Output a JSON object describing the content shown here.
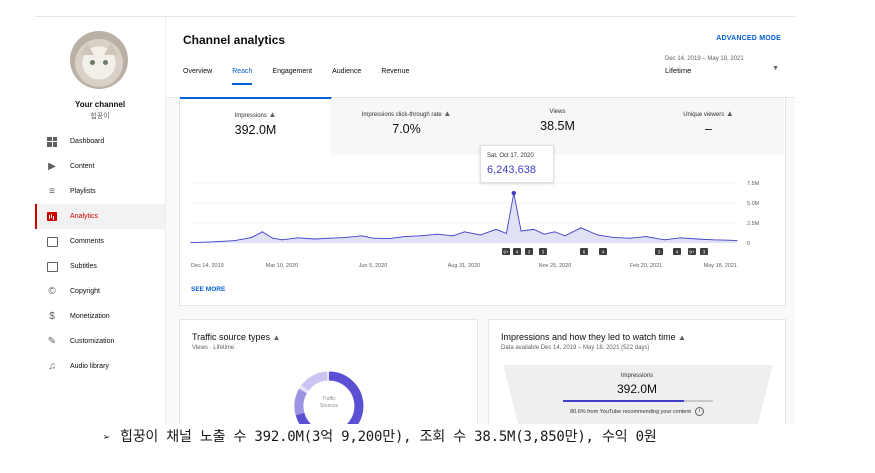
{
  "sidebar": {
    "channel_title": "Your channel",
    "channel_name": "힙꿍이",
    "items": [
      {
        "label": "Dashboard",
        "icon": "dashboard-icon",
        "active": false
      },
      {
        "label": "Content",
        "icon": "content-icon",
        "active": false
      },
      {
        "label": "Playlists",
        "icon": "playlists-icon",
        "active": false
      },
      {
        "label": "Analytics",
        "icon": "analytics-icon",
        "active": true
      },
      {
        "label": "Comments",
        "icon": "comments-icon",
        "active": false
      },
      {
        "label": "Subtitles",
        "icon": "subtitles-icon",
        "active": false
      },
      {
        "label": "Copyright",
        "icon": "copyright-icon",
        "active": false
      },
      {
        "label": "Monetization",
        "icon": "monetization-icon",
        "active": false
      },
      {
        "label": "Customization",
        "icon": "customization-icon",
        "active": false
      },
      {
        "label": "Audio library",
        "icon": "audio-library-icon",
        "active": false
      }
    ]
  },
  "header": {
    "title": "Channel analytics",
    "advanced_mode": "ADVANCED MODE",
    "tabs": [
      "Overview",
      "Reach",
      "Engagement",
      "Audience",
      "Revenue"
    ],
    "active_tab": "Reach",
    "date_range": "Dec 14, 2019 – May 18, 2021",
    "period": "Lifetime"
  },
  "metrics": [
    {
      "label": "Impressions",
      "value": "392.0M",
      "warning": true
    },
    {
      "label": "Impressions click-through rate",
      "value": "7.0%",
      "warning": true
    },
    {
      "label": "Views",
      "value": "38.5M",
      "warning": false
    },
    {
      "label": "Unique viewers",
      "value": "–",
      "warning": true
    }
  ],
  "tooltip": {
    "date": "Sat, Oct 17, 2020",
    "value": "6,243,638"
  },
  "chart_data": {
    "type": "area",
    "metric": "Impressions",
    "x_ticks": [
      "Dec 14, 2019",
      "Mar 10, 2020",
      "Jun 5, 2020",
      "Aug 31, 2020",
      "Nov 25, 2020",
      "Feb 20, 2021",
      "May 18, 2021"
    ],
    "y_ticks": [
      "7.5M",
      "5.0M",
      "2.5M",
      "0"
    ],
    "ylim": [
      0,
      7500000
    ],
    "x": [
      "2019-12-14",
      "2020-01-05",
      "2020-01-25",
      "2020-02-10",
      "2020-02-20",
      "2020-03-01",
      "2020-03-10",
      "2020-03-25",
      "2020-04-10",
      "2020-04-25",
      "2020-05-10",
      "2020-05-25",
      "2020-06-05",
      "2020-06-20",
      "2020-07-05",
      "2020-07-20",
      "2020-08-05",
      "2020-08-20",
      "2020-08-31",
      "2020-09-15",
      "2020-09-30",
      "2020-10-10",
      "2020-10-17",
      "2020-10-24",
      "2020-11-05",
      "2020-11-15",
      "2020-11-25",
      "2020-12-05",
      "2020-12-20",
      "2021-01-05",
      "2021-01-20",
      "2021-02-05",
      "2021-02-20",
      "2021-03-10",
      "2021-03-25",
      "2021-04-10",
      "2021-04-25",
      "2021-05-10",
      "2021-05-18"
    ],
    "values": [
      50000,
      150000,
      300000,
      700000,
      1400000,
      600000,
      400000,
      650000,
      500000,
      600000,
      700000,
      900000,
      600000,
      550000,
      800000,
      900000,
      1100000,
      900000,
      1400000,
      1000000,
      1700000,
      1200000,
      6243638,
      1500000,
      1700000,
      1100000,
      1400000,
      900000,
      1900000,
      1000000,
      700000,
      600000,
      800000,
      400000,
      650000,
      500000,
      400000,
      350000,
      300000
    ],
    "event_markers": [
      "9+",
      "4",
      "3",
      "3",
      "6",
      "4",
      "3",
      "4",
      "9+",
      "3"
    ],
    "grid": true,
    "legend": "none"
  },
  "see_more": "SEE MORE",
  "traffic": {
    "title": "Traffic source types",
    "subtitle": "Views · Lifetime",
    "donut_label_1": "Traffic",
    "donut_label_2": "Sources"
  },
  "impressions_card": {
    "title": "Impressions and how they led to watch time",
    "subtitle": "Data available Dec 14, 2019 – May 18, 2021 (522 days)",
    "funnel_label": "Impressions",
    "funnel_value": "392.0M",
    "funnel_fill": 0.806,
    "funnel_note": "80.6% from YouTube recommending your content"
  },
  "caption": "힙꿍이 채널 노출 수 392.0M(3억 9,200만), 조회 수 38.5M(3,850만), 수익 0원",
  "colors": {
    "accent": "#065fd4",
    "series": "#3e3ec8",
    "area": "#e1e1f6",
    "active_nav": "#cc0000"
  }
}
